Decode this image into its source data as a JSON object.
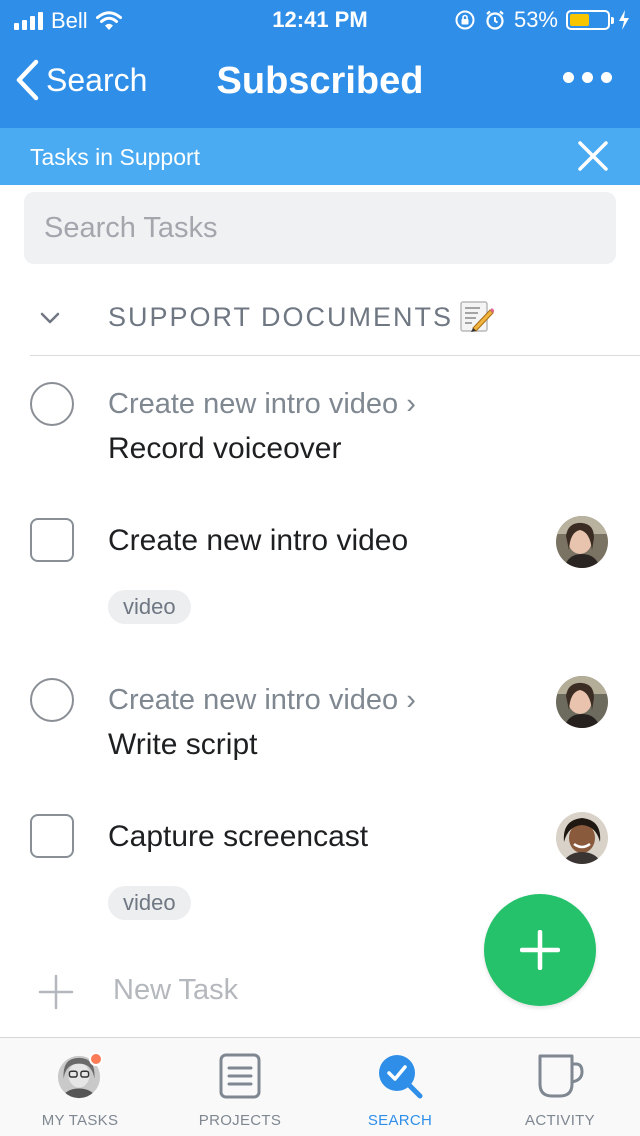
{
  "status_bar": {
    "carrier": "Bell",
    "time": "12:41 PM",
    "battery": "53%",
    "battery_level": 0.53
  },
  "nav": {
    "back_label": "Search",
    "title": "Subscribed"
  },
  "filter_bar": {
    "text": "Tasks in Support"
  },
  "search": {
    "placeholder": "Search Tasks"
  },
  "section": {
    "label": "SUPPORT DOCUMENTS"
  },
  "tasks": [
    {
      "parent": "Create new intro video ›",
      "name": "Record voiceover",
      "checkbox": "circle"
    },
    {
      "name": "Create new intro video",
      "tag": "video",
      "checkbox": "square"
    },
    {
      "parent": "Create new intro video ›",
      "name": "Write script",
      "checkbox": "circle"
    },
    {
      "name": "Capture screencast",
      "tag": "video",
      "checkbox": "square"
    }
  ],
  "new_task": {
    "label": "New Task"
  },
  "tab_bar": {
    "tabs": [
      {
        "label": "MY TASKS",
        "icon": "user-avatar-icon"
      },
      {
        "label": "PROJECTS",
        "icon": "projects-list-icon"
      },
      {
        "label": "SEARCH",
        "icon": "search-icon",
        "active": true
      },
      {
        "label": "ACTIVITY",
        "icon": "mug-icon"
      }
    ]
  },
  "colors": {
    "header": "#2f8fe8",
    "filter_bar": "#4aabf2",
    "fab": "#25c26b",
    "active_tab": "#2f8fe8",
    "battery": "#f7c600"
  }
}
